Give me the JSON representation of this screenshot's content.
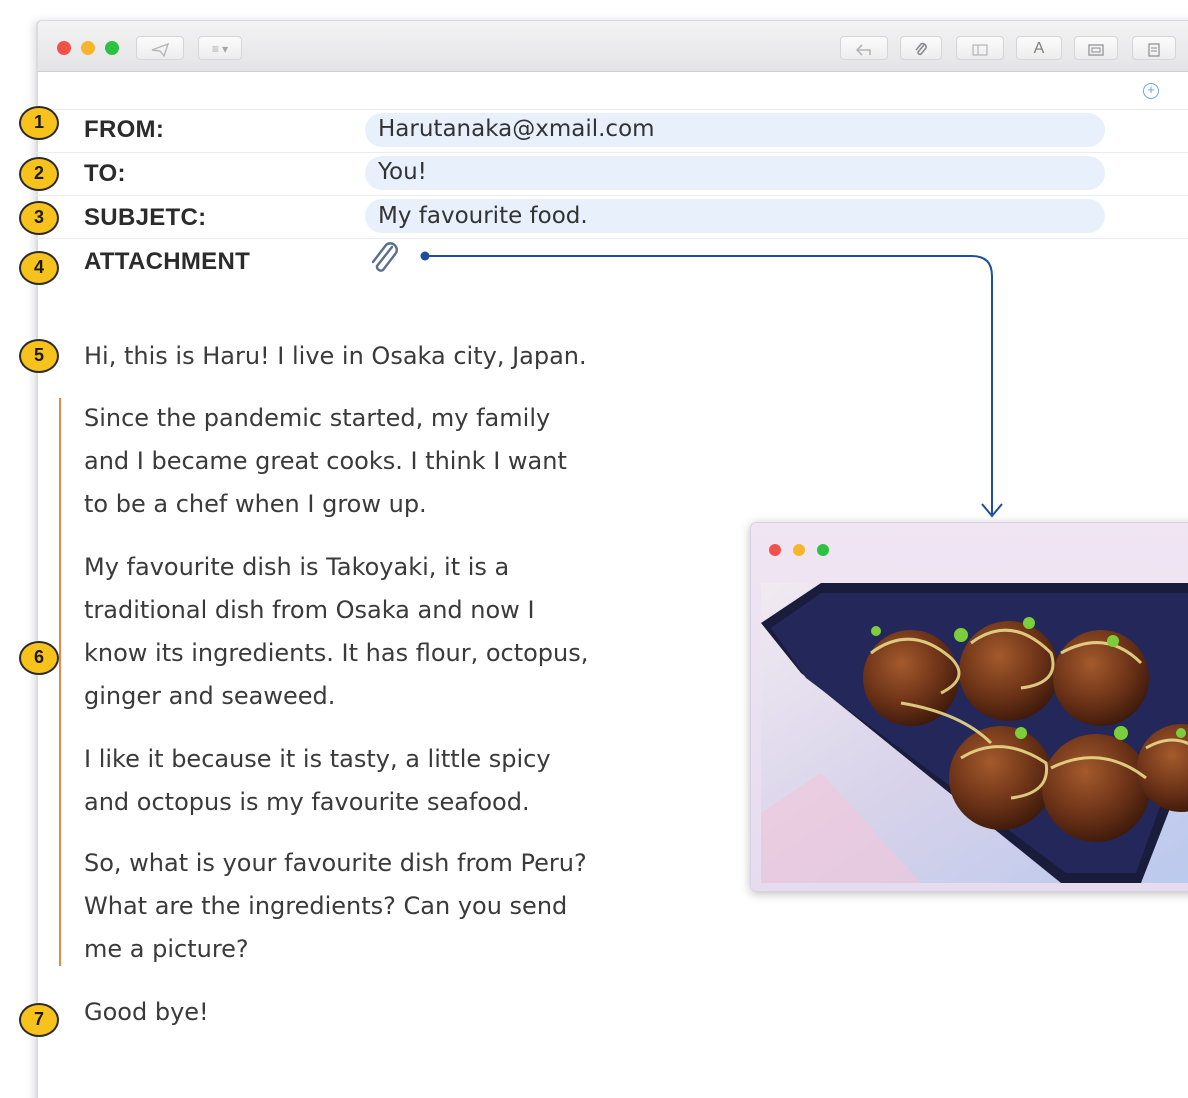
{
  "toolbar": {
    "format_label": "≡ ▾",
    "font_label": "A"
  },
  "header": {
    "from_label": "FROM:",
    "from_value": "Harutanaka@xmail.com",
    "to_label": "TO:",
    "to_value": "You!",
    "subject_label": "SUBJETC:",
    "subject_value": "My favourite food.",
    "attachment_label": "ATTACHMENT"
  },
  "badges": [
    "1",
    "2",
    "3",
    "4",
    "5",
    "6",
    "7"
  ],
  "body": {
    "greeting": "Hi, this is Haru! I live in Osaka city, Japan.",
    "paragraph1": [
      "Since the pandemic started, my family",
      "and I became great cooks. I think I want",
      "to be a chef when I grow up."
    ],
    "paragraph2": [
      "My favourite dish is Takoyaki, it is a",
      "traditional dish from Osaka and now I",
      "know its ingredients. It has flour, octopus,",
      "ginger and seaweed."
    ],
    "paragraph3": [
      "I like it because it is tasty, a little spicy",
      "and octopus is my favourite seafood."
    ],
    "paragraph4": [
      "So, what is your favourite dish from Peru?",
      "What are the ingredients? Can you send",
      "me a picture?"
    ],
    "closing": "Good bye!"
  },
  "colors": {
    "badge": "#f8c21c",
    "header_pill": "#e8f1fb",
    "quote_bar": "#e8874a",
    "connector": "#1f4e9c"
  },
  "icons": {
    "attachment": "paperclip-icon",
    "photo": "takoyaki-photo"
  }
}
